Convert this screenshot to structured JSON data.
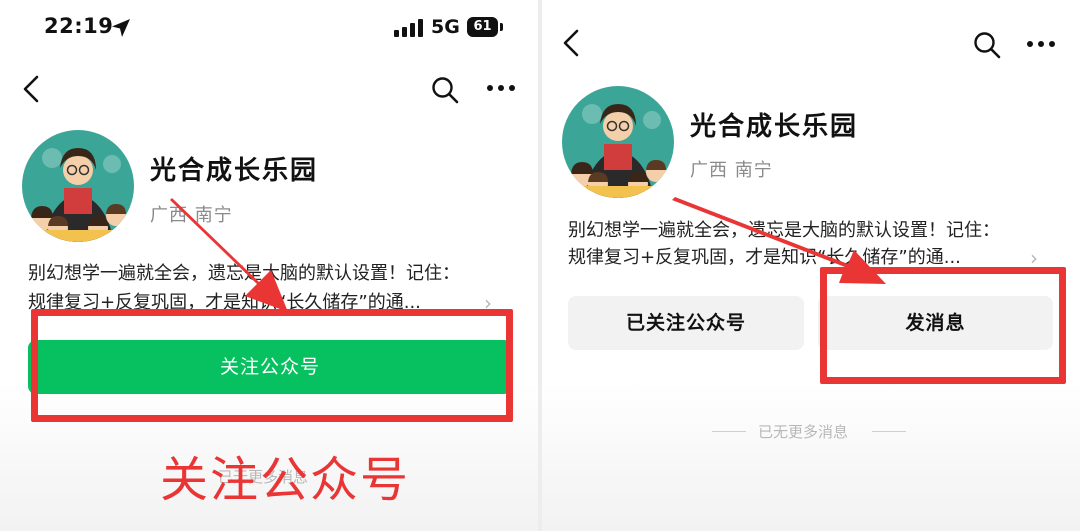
{
  "status_bar": {
    "time": "22:19",
    "network": "5G",
    "battery": "61"
  },
  "account": {
    "name": "光合成长乐园",
    "location": "广西 南宁",
    "description_line1": "别幻想学一遍就全会，遗忘是大脑的默认设置！记住：",
    "description_line2": "规律复习+反复巩固，才是知识“长久储存”的通..."
  },
  "left_screen": {
    "follow_button_label": "关注公众号",
    "annotation_label": "关注公众号",
    "no_more_messages": "已无更多消息"
  },
  "right_screen": {
    "followed_button_label": "已关注公众号",
    "message_button_label": "发消息",
    "no_more_messages": "已无更多消息"
  },
  "icons": {
    "back": "back-arrow-icon",
    "search": "search-icon",
    "more": "more-dots-icon",
    "location_arrow": "location-arrow-icon",
    "signal": "signal-bars-icon",
    "battery": "battery-icon",
    "chevron": "chevron-right-icon"
  },
  "colors": {
    "follow_green": "#07c160",
    "annotation_red": "#ea3535",
    "button_gray": "#f2f2f2"
  }
}
